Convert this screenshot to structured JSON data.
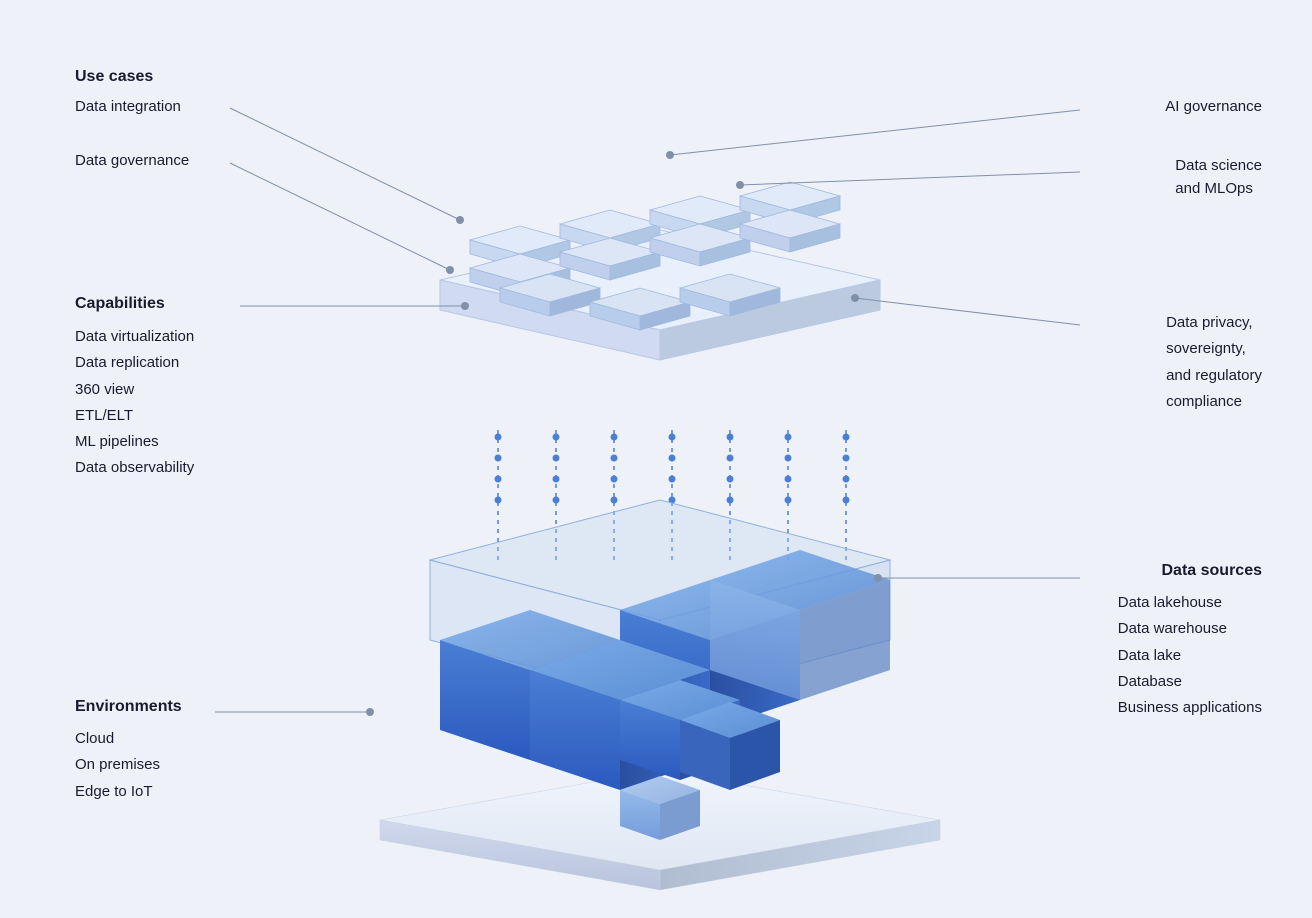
{
  "left": {
    "use_cases_title": "Use cases",
    "data_integration": "Data integration",
    "data_governance": "Data governance",
    "capabilities_title": "Capabilities",
    "capabilities_list": [
      "Data virtualization",
      "Data replication",
      "360 view",
      "ETL/ELT",
      "ML pipelines",
      "Data observability"
    ],
    "environments_title": "Environments",
    "environments_list": [
      "Cloud",
      "On premises",
      "Edge to IoT"
    ]
  },
  "right": {
    "ai_governance": "AI governance",
    "data_science_label": "Data science\nand MLOps",
    "data_privacy_label": "Data privacy,\nsovereignty,\nand regulatory\ncompliance",
    "data_sources_title": "Data sources",
    "data_sources_list": [
      "Data lakehouse",
      "Data warehouse",
      "Data lake",
      "Database",
      "Business applications"
    ]
  }
}
